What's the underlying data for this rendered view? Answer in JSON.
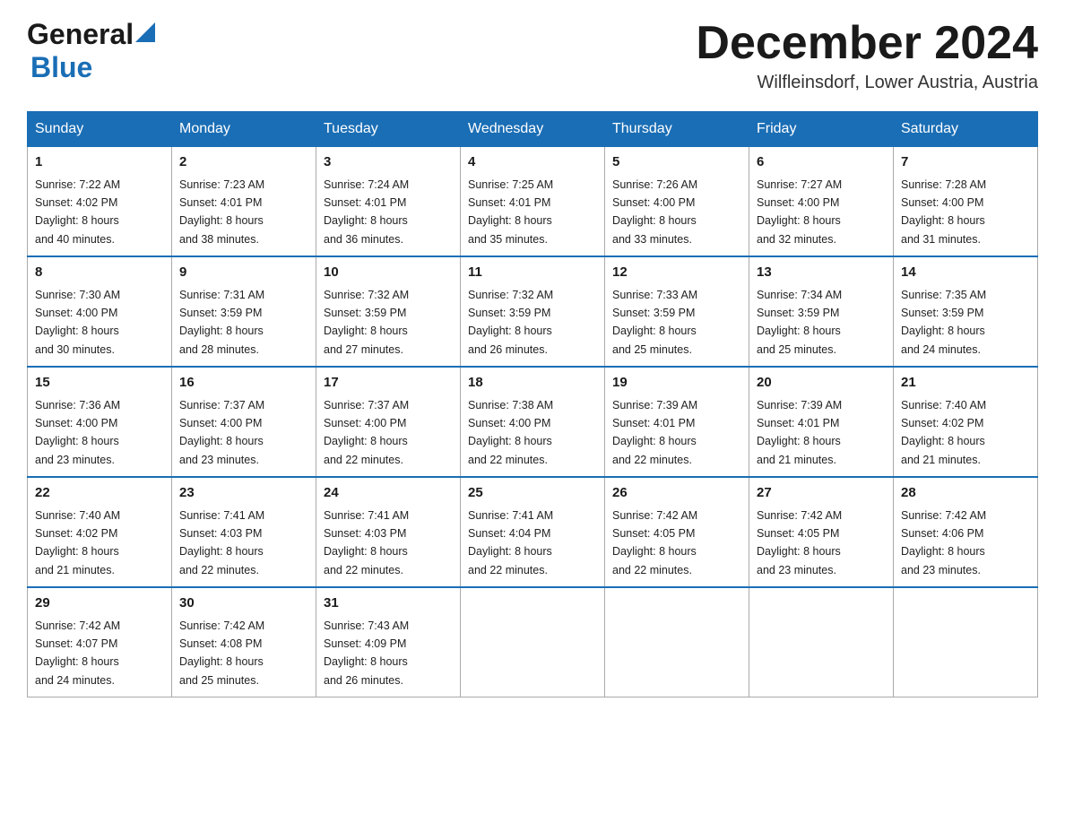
{
  "logo": {
    "general": "General",
    "blue": "Blue",
    "arrow": "▶"
  },
  "title": "December 2024",
  "location": "Wilfleinsdorf, Lower Austria, Austria",
  "days_of_week": [
    "Sunday",
    "Monday",
    "Tuesday",
    "Wednesday",
    "Thursday",
    "Friday",
    "Saturday"
  ],
  "weeks": [
    [
      {
        "day": "1",
        "sunrise": "7:22 AM",
        "sunset": "4:02 PM",
        "daylight": "8 hours and 40 minutes."
      },
      {
        "day": "2",
        "sunrise": "7:23 AM",
        "sunset": "4:01 PM",
        "daylight": "8 hours and 38 minutes."
      },
      {
        "day": "3",
        "sunrise": "7:24 AM",
        "sunset": "4:01 PM",
        "daylight": "8 hours and 36 minutes."
      },
      {
        "day": "4",
        "sunrise": "7:25 AM",
        "sunset": "4:01 PM",
        "daylight": "8 hours and 35 minutes."
      },
      {
        "day": "5",
        "sunrise": "7:26 AM",
        "sunset": "4:00 PM",
        "daylight": "8 hours and 33 minutes."
      },
      {
        "day": "6",
        "sunrise": "7:27 AM",
        "sunset": "4:00 PM",
        "daylight": "8 hours and 32 minutes."
      },
      {
        "day": "7",
        "sunrise": "7:28 AM",
        "sunset": "4:00 PM",
        "daylight": "8 hours and 31 minutes."
      }
    ],
    [
      {
        "day": "8",
        "sunrise": "7:30 AM",
        "sunset": "4:00 PM",
        "daylight": "8 hours and 30 minutes."
      },
      {
        "day": "9",
        "sunrise": "7:31 AM",
        "sunset": "3:59 PM",
        "daylight": "8 hours and 28 minutes."
      },
      {
        "day": "10",
        "sunrise": "7:32 AM",
        "sunset": "3:59 PM",
        "daylight": "8 hours and 27 minutes."
      },
      {
        "day": "11",
        "sunrise": "7:32 AM",
        "sunset": "3:59 PM",
        "daylight": "8 hours and 26 minutes."
      },
      {
        "day": "12",
        "sunrise": "7:33 AM",
        "sunset": "3:59 PM",
        "daylight": "8 hours and 25 minutes."
      },
      {
        "day": "13",
        "sunrise": "7:34 AM",
        "sunset": "3:59 PM",
        "daylight": "8 hours and 25 minutes."
      },
      {
        "day": "14",
        "sunrise": "7:35 AM",
        "sunset": "3:59 PM",
        "daylight": "8 hours and 24 minutes."
      }
    ],
    [
      {
        "day": "15",
        "sunrise": "7:36 AM",
        "sunset": "4:00 PM",
        "daylight": "8 hours and 23 minutes."
      },
      {
        "day": "16",
        "sunrise": "7:37 AM",
        "sunset": "4:00 PM",
        "daylight": "8 hours and 23 minutes."
      },
      {
        "day": "17",
        "sunrise": "7:37 AM",
        "sunset": "4:00 PM",
        "daylight": "8 hours and 22 minutes."
      },
      {
        "day": "18",
        "sunrise": "7:38 AM",
        "sunset": "4:00 PM",
        "daylight": "8 hours and 22 minutes."
      },
      {
        "day": "19",
        "sunrise": "7:39 AM",
        "sunset": "4:01 PM",
        "daylight": "8 hours and 22 minutes."
      },
      {
        "day": "20",
        "sunrise": "7:39 AM",
        "sunset": "4:01 PM",
        "daylight": "8 hours and 21 minutes."
      },
      {
        "day": "21",
        "sunrise": "7:40 AM",
        "sunset": "4:02 PM",
        "daylight": "8 hours and 21 minutes."
      }
    ],
    [
      {
        "day": "22",
        "sunrise": "7:40 AM",
        "sunset": "4:02 PM",
        "daylight": "8 hours and 21 minutes."
      },
      {
        "day": "23",
        "sunrise": "7:41 AM",
        "sunset": "4:03 PM",
        "daylight": "8 hours and 22 minutes."
      },
      {
        "day": "24",
        "sunrise": "7:41 AM",
        "sunset": "4:03 PM",
        "daylight": "8 hours and 22 minutes."
      },
      {
        "day": "25",
        "sunrise": "7:41 AM",
        "sunset": "4:04 PM",
        "daylight": "8 hours and 22 minutes."
      },
      {
        "day": "26",
        "sunrise": "7:42 AM",
        "sunset": "4:05 PM",
        "daylight": "8 hours and 22 minutes."
      },
      {
        "day": "27",
        "sunrise": "7:42 AM",
        "sunset": "4:05 PM",
        "daylight": "8 hours and 23 minutes."
      },
      {
        "day": "28",
        "sunrise": "7:42 AM",
        "sunset": "4:06 PM",
        "daylight": "8 hours and 23 minutes."
      }
    ],
    [
      {
        "day": "29",
        "sunrise": "7:42 AM",
        "sunset": "4:07 PM",
        "daylight": "8 hours and 24 minutes."
      },
      {
        "day": "30",
        "sunrise": "7:42 AM",
        "sunset": "4:08 PM",
        "daylight": "8 hours and 25 minutes."
      },
      {
        "day": "31",
        "sunrise": "7:43 AM",
        "sunset": "4:09 PM",
        "daylight": "8 hours and 26 minutes."
      },
      null,
      null,
      null,
      null
    ]
  ],
  "labels": {
    "sunrise": "Sunrise:",
    "sunset": "Sunset:",
    "daylight": "Daylight:"
  }
}
